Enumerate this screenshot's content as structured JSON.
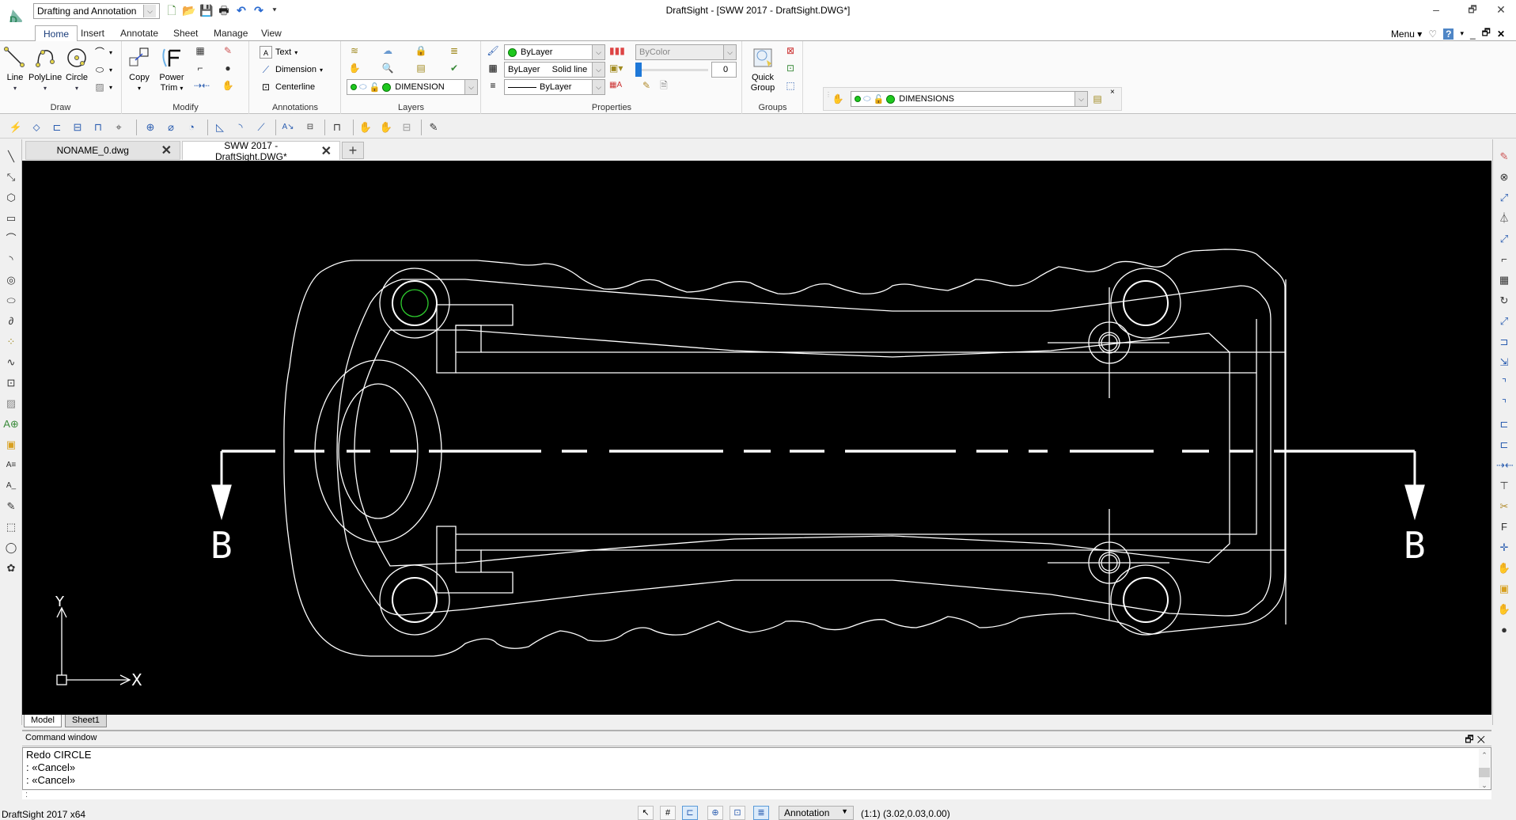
{
  "app": {
    "title": "DraftSight - [SWW 2017 - DraftSight.DWG*]",
    "workspace": "Drafting and Annotation",
    "status_app_name": "DraftSight 2017 x64"
  },
  "quick_access": [
    {
      "name": "new-file-icon",
      "glyph": "🗋"
    },
    {
      "name": "open-file-icon",
      "glyph": "📂"
    },
    {
      "name": "save-icon",
      "glyph": "💾"
    },
    {
      "name": "print-icon",
      "glyph": "🖶"
    },
    {
      "name": "undo-icon",
      "glyph": "↶"
    },
    {
      "name": "redo-icon",
      "glyph": "↷"
    },
    {
      "name": "customize-icon",
      "glyph": "⯆"
    }
  ],
  "ribbon_tabs": [
    {
      "label": "Home",
      "active": true
    },
    {
      "label": "Insert"
    },
    {
      "label": "Annotate"
    },
    {
      "label": "Sheet"
    },
    {
      "label": "Manage"
    },
    {
      "label": "View"
    }
  ],
  "menu_label": "Menu",
  "ribbon": {
    "draw": {
      "label": "Draw",
      "line": "Line",
      "polyline": "PolyLine",
      "circle": "Circle"
    },
    "modify": {
      "label": "Modify",
      "copy": "Copy",
      "power_trim_1": "Power",
      "power_trim_2": "Trim"
    },
    "annotations": {
      "label": "Annotations",
      "text": "Text",
      "dimension": "Dimension",
      "centerline": "Centerline"
    },
    "layers": {
      "label": "Layers",
      "current_layer": "DIMENSION"
    },
    "properties": {
      "label": "Properties",
      "color": "ByLayer",
      "linestyle_1": "ByLayer",
      "linestyle_2": "Solid line",
      "lineweight": "ByLayer",
      "print_style": "ByColor",
      "transparency": "0",
      "transparency_value": 0
    },
    "groups": {
      "label": "Groups",
      "quick_group_1": "Quick",
      "quick_group_2": "Group"
    },
    "layer_toolbar": {
      "current_layer": "DIMENSIONS"
    }
  },
  "document_tabs": [
    {
      "label": "NONAME_0.dwg",
      "active": false
    },
    {
      "label": "SWW 2017 - DraftSight.DWG*",
      "active": true
    }
  ],
  "layout_tabs": [
    {
      "label": "Model",
      "active": true
    },
    {
      "label": "Sheet1",
      "active": false
    }
  ],
  "canvas": {
    "background": "#000000",
    "line_color": "#ffffff",
    "highlight_color": "#2ecc2e",
    "section_label_left": "B",
    "section_label_right": "B",
    "ucs_x_label": "X",
    "ucs_y_label": "Y"
  },
  "command_window": {
    "title": "Command window",
    "lines": [
      "Redo CIRCLE",
      ": «Cancel»",
      ": «Cancel»"
    ],
    "prompt": ":"
  },
  "status_bar": {
    "annotation_scale_label": "Annotation",
    "scale": "(1:1)",
    "coordinates": "(3.02,0.03,0.00)"
  }
}
